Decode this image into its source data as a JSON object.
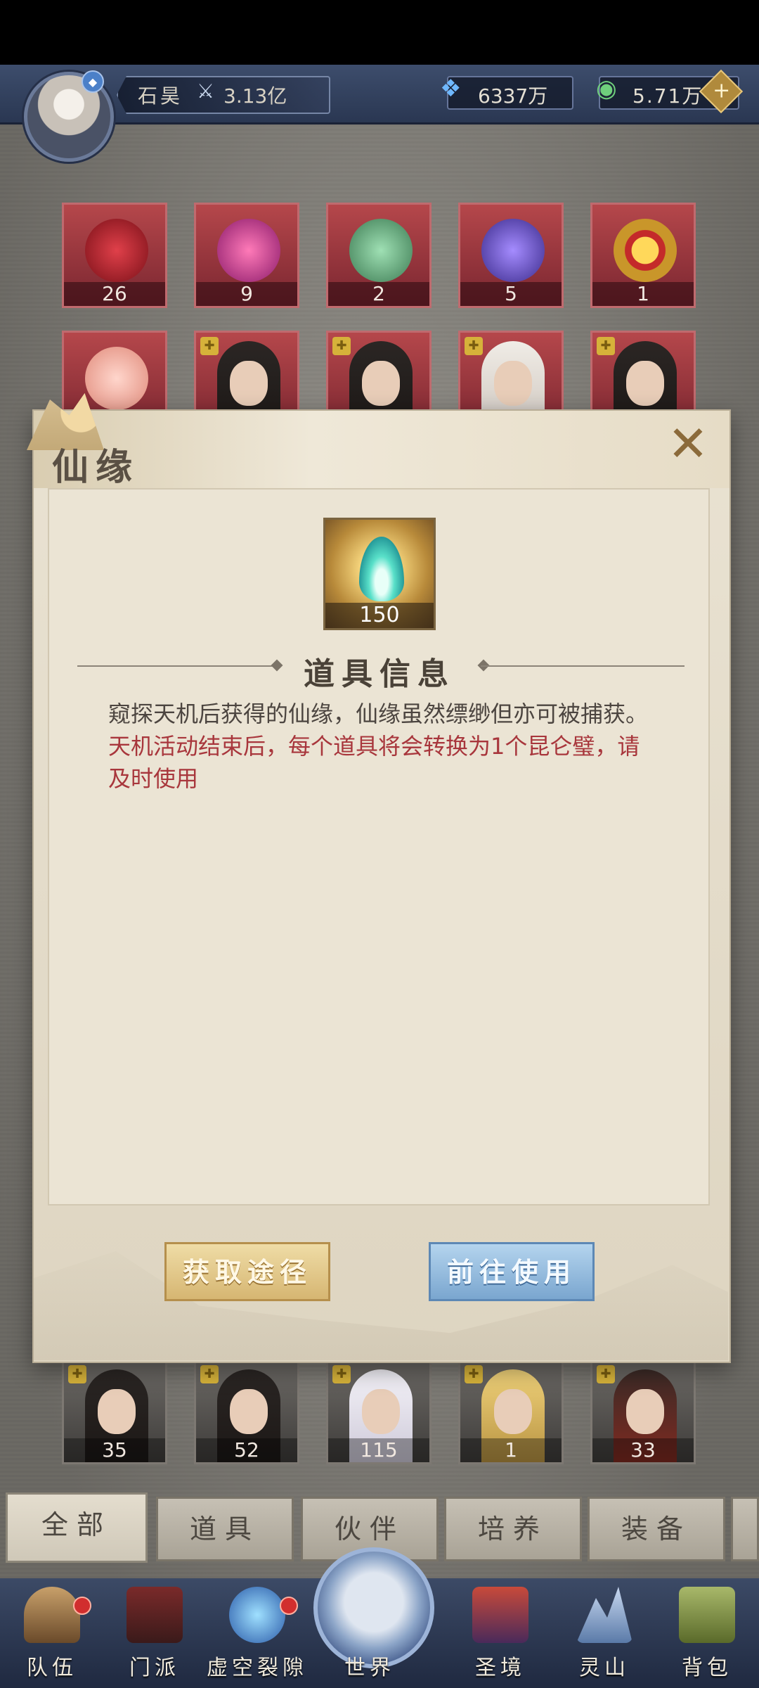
{
  "header": {
    "player_name": "石昊",
    "power_value": "3.13亿",
    "crystal_value": "6337万",
    "jade_value": "5.71万"
  },
  "grid": {
    "row1": [
      {
        "count": "26",
        "icon": "red-token-icon"
      },
      {
        "count": "9",
        "icon": "purple-orb-icon"
      },
      {
        "count": "2",
        "icon": "jade-stone-icon"
      },
      {
        "count": "5",
        "icon": "violet-sphere-icon"
      },
      {
        "count": "1",
        "icon": "gold-ring-icon"
      }
    ],
    "row3": [
      {
        "count": "35"
      },
      {
        "count": "52"
      },
      {
        "count": "115"
      },
      {
        "count": "1"
      },
      {
        "count": "33"
      }
    ]
  },
  "modal": {
    "title": "仙缘",
    "item_count": "150",
    "section_title": "道具信息",
    "desc_black": "窥探天机后获得的仙缘，仙缘虽然缥缈但亦可被捕获。",
    "desc_red": "天机活动结束后，每个道具将会转换为1个昆仑璧，请及时使用",
    "btn_obtain": "获取途径",
    "btn_use": "前往使用"
  },
  "tabs": [
    "全部",
    "道具",
    "伙伴",
    "培养",
    "装备"
  ],
  "nav": [
    "队伍",
    "门派",
    "虚空裂隙",
    "世界",
    "圣境",
    "灵山",
    "背包"
  ],
  "colors": {
    "red_text": "#a8363c",
    "slot_red": "#b5474b",
    "button_gold": "#d6b672",
    "button_blue": "#7aa6cf"
  }
}
